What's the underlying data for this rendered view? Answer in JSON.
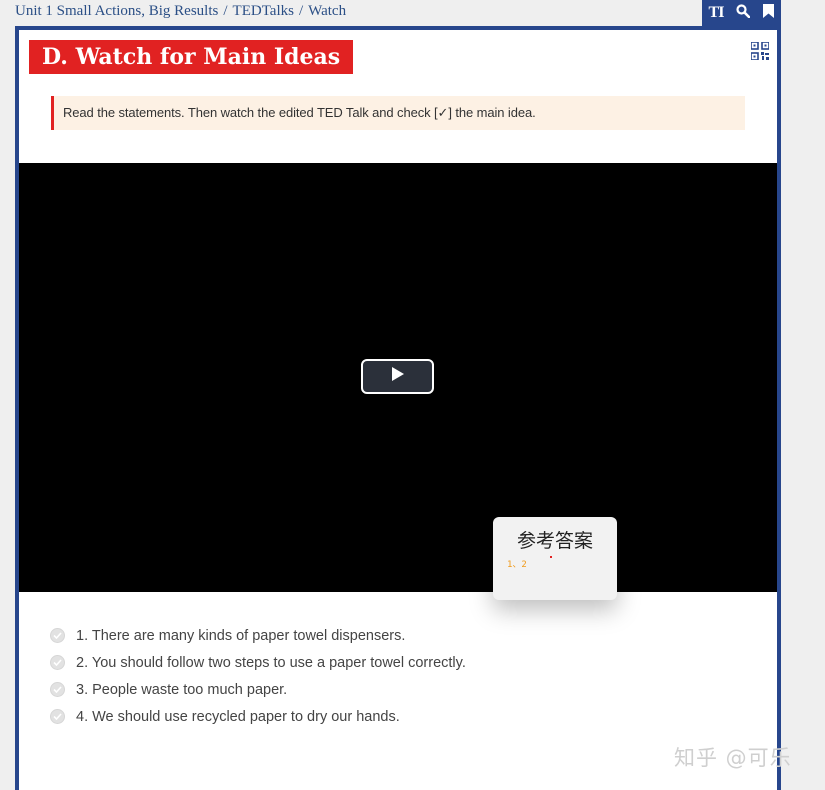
{
  "breadcrumb": {
    "items": [
      "Unit 1 Small Actions, Big Results",
      "TEDTalks",
      "Watch"
    ],
    "separator": "/"
  },
  "topbar": {
    "text_button": "TI",
    "icons": [
      "search-icon",
      "bookmark-icon"
    ],
    "bg_color": "#27468c"
  },
  "section": {
    "title": "D. Watch for Main Ideas",
    "title_bg": "#e12222"
  },
  "instruction": "Read the statements. Then watch the edited TED Talk and check [✓] the main idea.",
  "video": {
    "play_icon": "play-icon"
  },
  "answer_popup": {
    "title": "参考答案",
    "answer": "1、2"
  },
  "statements": [
    "1. There are many kinds of paper towel dispensers.",
    "2. You should follow two steps to use a paper towel correctly.",
    "3. People waste too much paper.",
    "4. We should use recycled paper to dry our hands."
  ],
  "watermark": "知乎 @可乐"
}
